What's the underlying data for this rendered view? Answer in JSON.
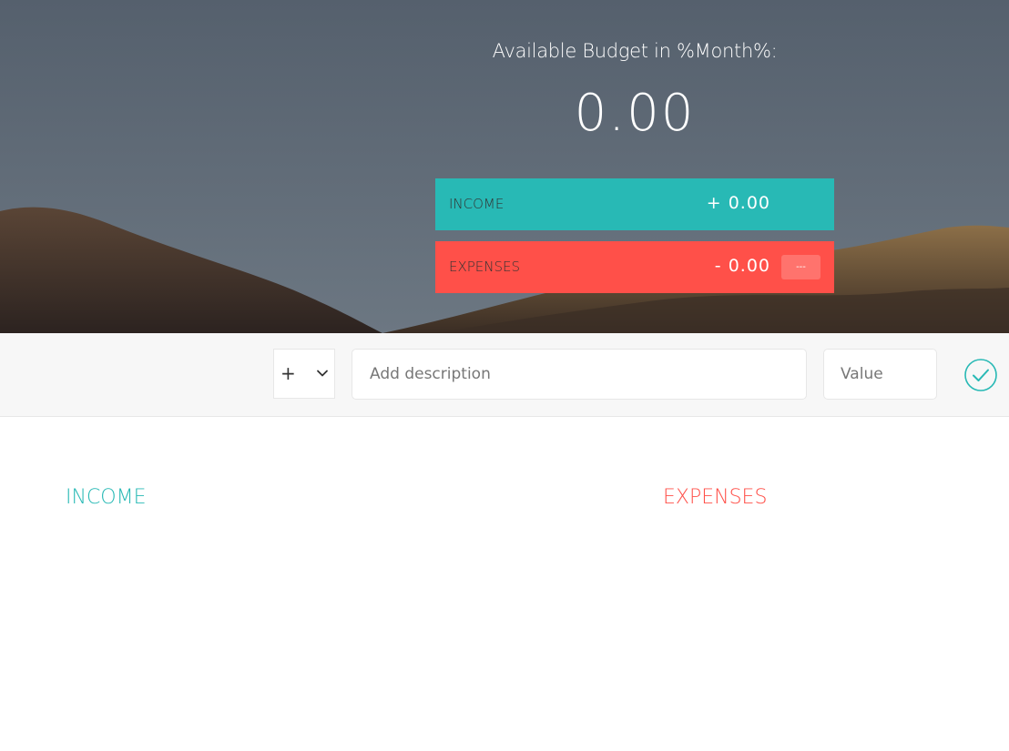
{
  "budget": {
    "title": "Available Budget in %Month%:",
    "value": "0.00",
    "income": {
      "label": "INCOME",
      "value": "+ 0.00"
    },
    "expenses": {
      "label": "EXPENSES",
      "value": "- 0.00",
      "percentage": "---"
    }
  },
  "add": {
    "type_selected": "+",
    "type_options": [
      "+",
      "-"
    ],
    "description_placeholder": "Add description",
    "value_placeholder": "Value",
    "submit_icon": "checkmark-circle-icon"
  },
  "lists": {
    "income_title": "INCOME",
    "expenses_title": "EXPENSES"
  },
  "colors": {
    "income": "#28b9b5",
    "expenses": "#ff5049"
  }
}
